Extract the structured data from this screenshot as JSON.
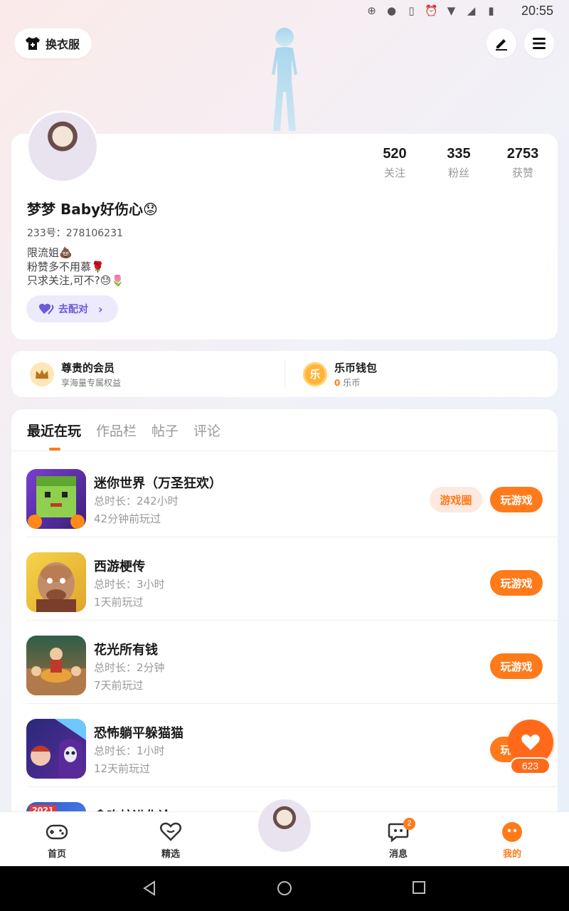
{
  "status_bar": {
    "time": "20:55"
  },
  "header": {
    "outfit_label": "换衣服"
  },
  "profile": {
    "stats": [
      {
        "value": "520",
        "label": "关注"
      },
      {
        "value": "335",
        "label": "粉丝"
      },
      {
        "value": "2753",
        "label": "获赞"
      }
    ],
    "username": "梦梦 Baby好伤心😟",
    "uid": "233号：278106231",
    "bio_lines": [
      "限流姐💩",
      "粉赞多不用慕🌹",
      "只求关注,可不?😓🌷"
    ],
    "pair_label": "去配对"
  },
  "wallet": {
    "vip_title": "尊贵的会员",
    "vip_sub": "享海量专属权益",
    "coin_title": "乐币钱包",
    "coin_icon_char": "乐",
    "coin_amount": "0",
    "coin_unit": "乐币"
  },
  "tabs": [
    "最近在玩",
    "作品栏",
    "帖子",
    "评论"
  ],
  "games": [
    {
      "name": "迷你世界（万圣狂欢）",
      "duration": "总时长：242小时",
      "last_played": "42分钟前玩过",
      "circle_label": "游戏圈",
      "play_label": "玩游戏"
    },
    {
      "name": "西游梗传",
      "duration": "总时长：3小时",
      "last_played": "1天前玩过",
      "play_label": "玩游戏"
    },
    {
      "name": "花光所有钱",
      "duration": "总时长：2分钟",
      "last_played": "7天前玩过",
      "play_label": "玩游戏"
    },
    {
      "name": "恐怖躺平躲猫猫",
      "duration": "总时长：1小时",
      "last_played": "12天前玩过",
      "play_label": "玩游戏"
    },
    {
      "name": "贪吃蛇进化论",
      "badge": "2021"
    }
  ],
  "like": {
    "count": "623"
  },
  "nav": {
    "items": [
      {
        "label": "首页"
      },
      {
        "label": "精选"
      },
      {
        "label": "消息",
        "badge": "2"
      },
      {
        "label": "我的"
      }
    ]
  },
  "colors": {
    "accent": "#ff7a1a",
    "purple": "#6b5ad9"
  }
}
